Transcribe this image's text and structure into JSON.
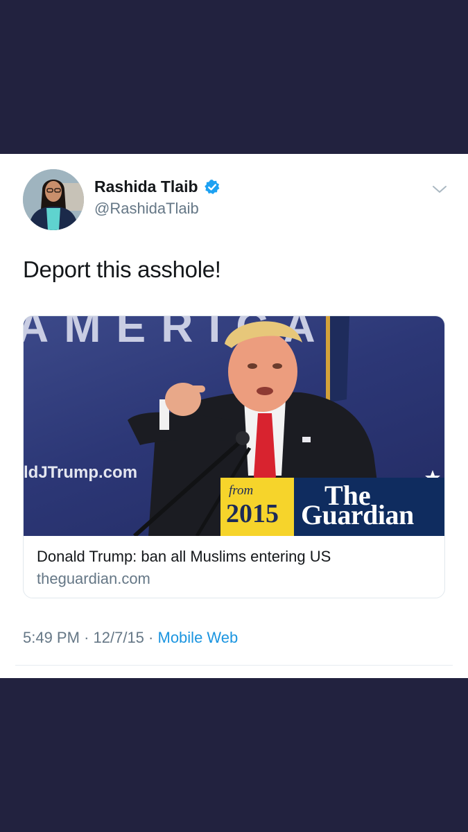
{
  "tweet": {
    "author": {
      "display_name": "Rashida Tlaib",
      "handle": "@RashidaTlaib",
      "verified": true,
      "avatar_icon": "profile-photo"
    },
    "text": "Deport this asshole!",
    "card": {
      "image_overlay": {
        "from_label": "from",
        "year": "2015",
        "brand_line1": "The",
        "brand_line2": "Guardian",
        "background_text": "AMERICA",
        "watermark": "ldJTrump.com"
      },
      "title": "Donald Trump: ban all Muslims entering US",
      "domain": "theguardian.com"
    },
    "meta": {
      "time": "5:49 PM",
      "separator": "·",
      "date": "12/7/15",
      "source": "Mobile Web"
    }
  },
  "colors": {
    "page_background": "#22223f",
    "link_blue": "#1b95e0",
    "secondary_gray": "#657786",
    "badge_yellow": "#f6d42b",
    "brand_navy": "#0f2c5f"
  }
}
